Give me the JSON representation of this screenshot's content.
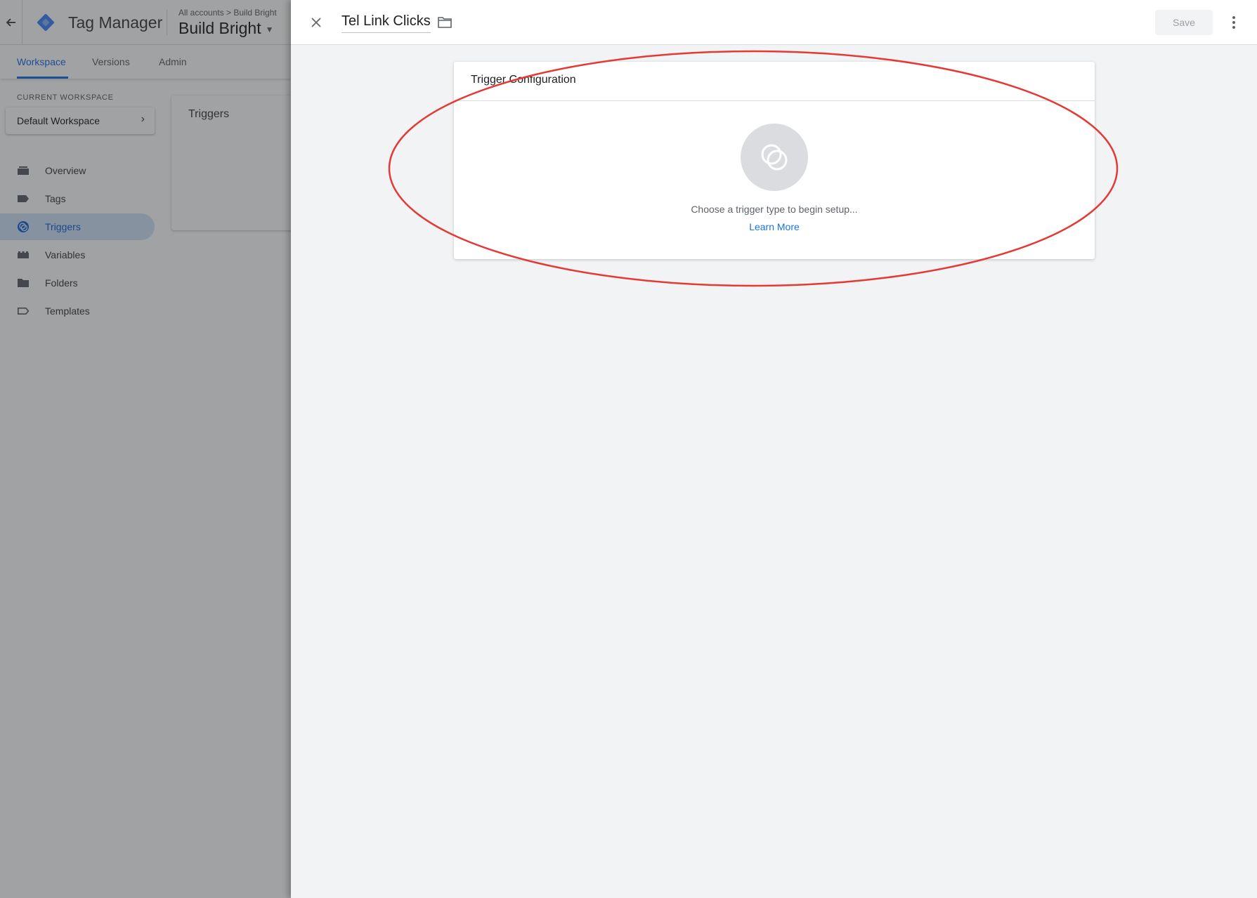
{
  "app": {
    "product_name": "Tag Manager",
    "breadcrumb": "All accounts > Build Bright",
    "container_name": "Build Bright"
  },
  "tabs": [
    {
      "label": "Workspace",
      "active": true
    },
    {
      "label": "Versions",
      "active": false
    },
    {
      "label": "Admin",
      "active": false
    }
  ],
  "workspace": {
    "section_label": "CURRENT WORKSPACE",
    "name": "Default Workspace"
  },
  "sidebar": {
    "items": [
      {
        "label": "Overview",
        "icon": "overview-icon",
        "active": false
      },
      {
        "label": "Tags",
        "icon": "tag-icon",
        "active": false
      },
      {
        "label": "Triggers",
        "icon": "trigger-icon",
        "active": true
      },
      {
        "label": "Variables",
        "icon": "variables-icon",
        "active": false
      },
      {
        "label": "Folders",
        "icon": "folder-icon",
        "active": false
      },
      {
        "label": "Templates",
        "icon": "templates-icon",
        "active": false
      }
    ]
  },
  "list_card": {
    "title": "Triggers"
  },
  "sheet": {
    "trigger_name": "Tel Link Clicks",
    "save_label": "Save"
  },
  "config": {
    "title": "Trigger Configuration",
    "prompt": "Choose a trigger type to begin setup...",
    "learn_more": "Learn More"
  },
  "colors": {
    "accent": "#1a73e8",
    "active_nav_bg": "#d2e3fc",
    "annotation": "#e53935",
    "scrim": "#202124"
  }
}
